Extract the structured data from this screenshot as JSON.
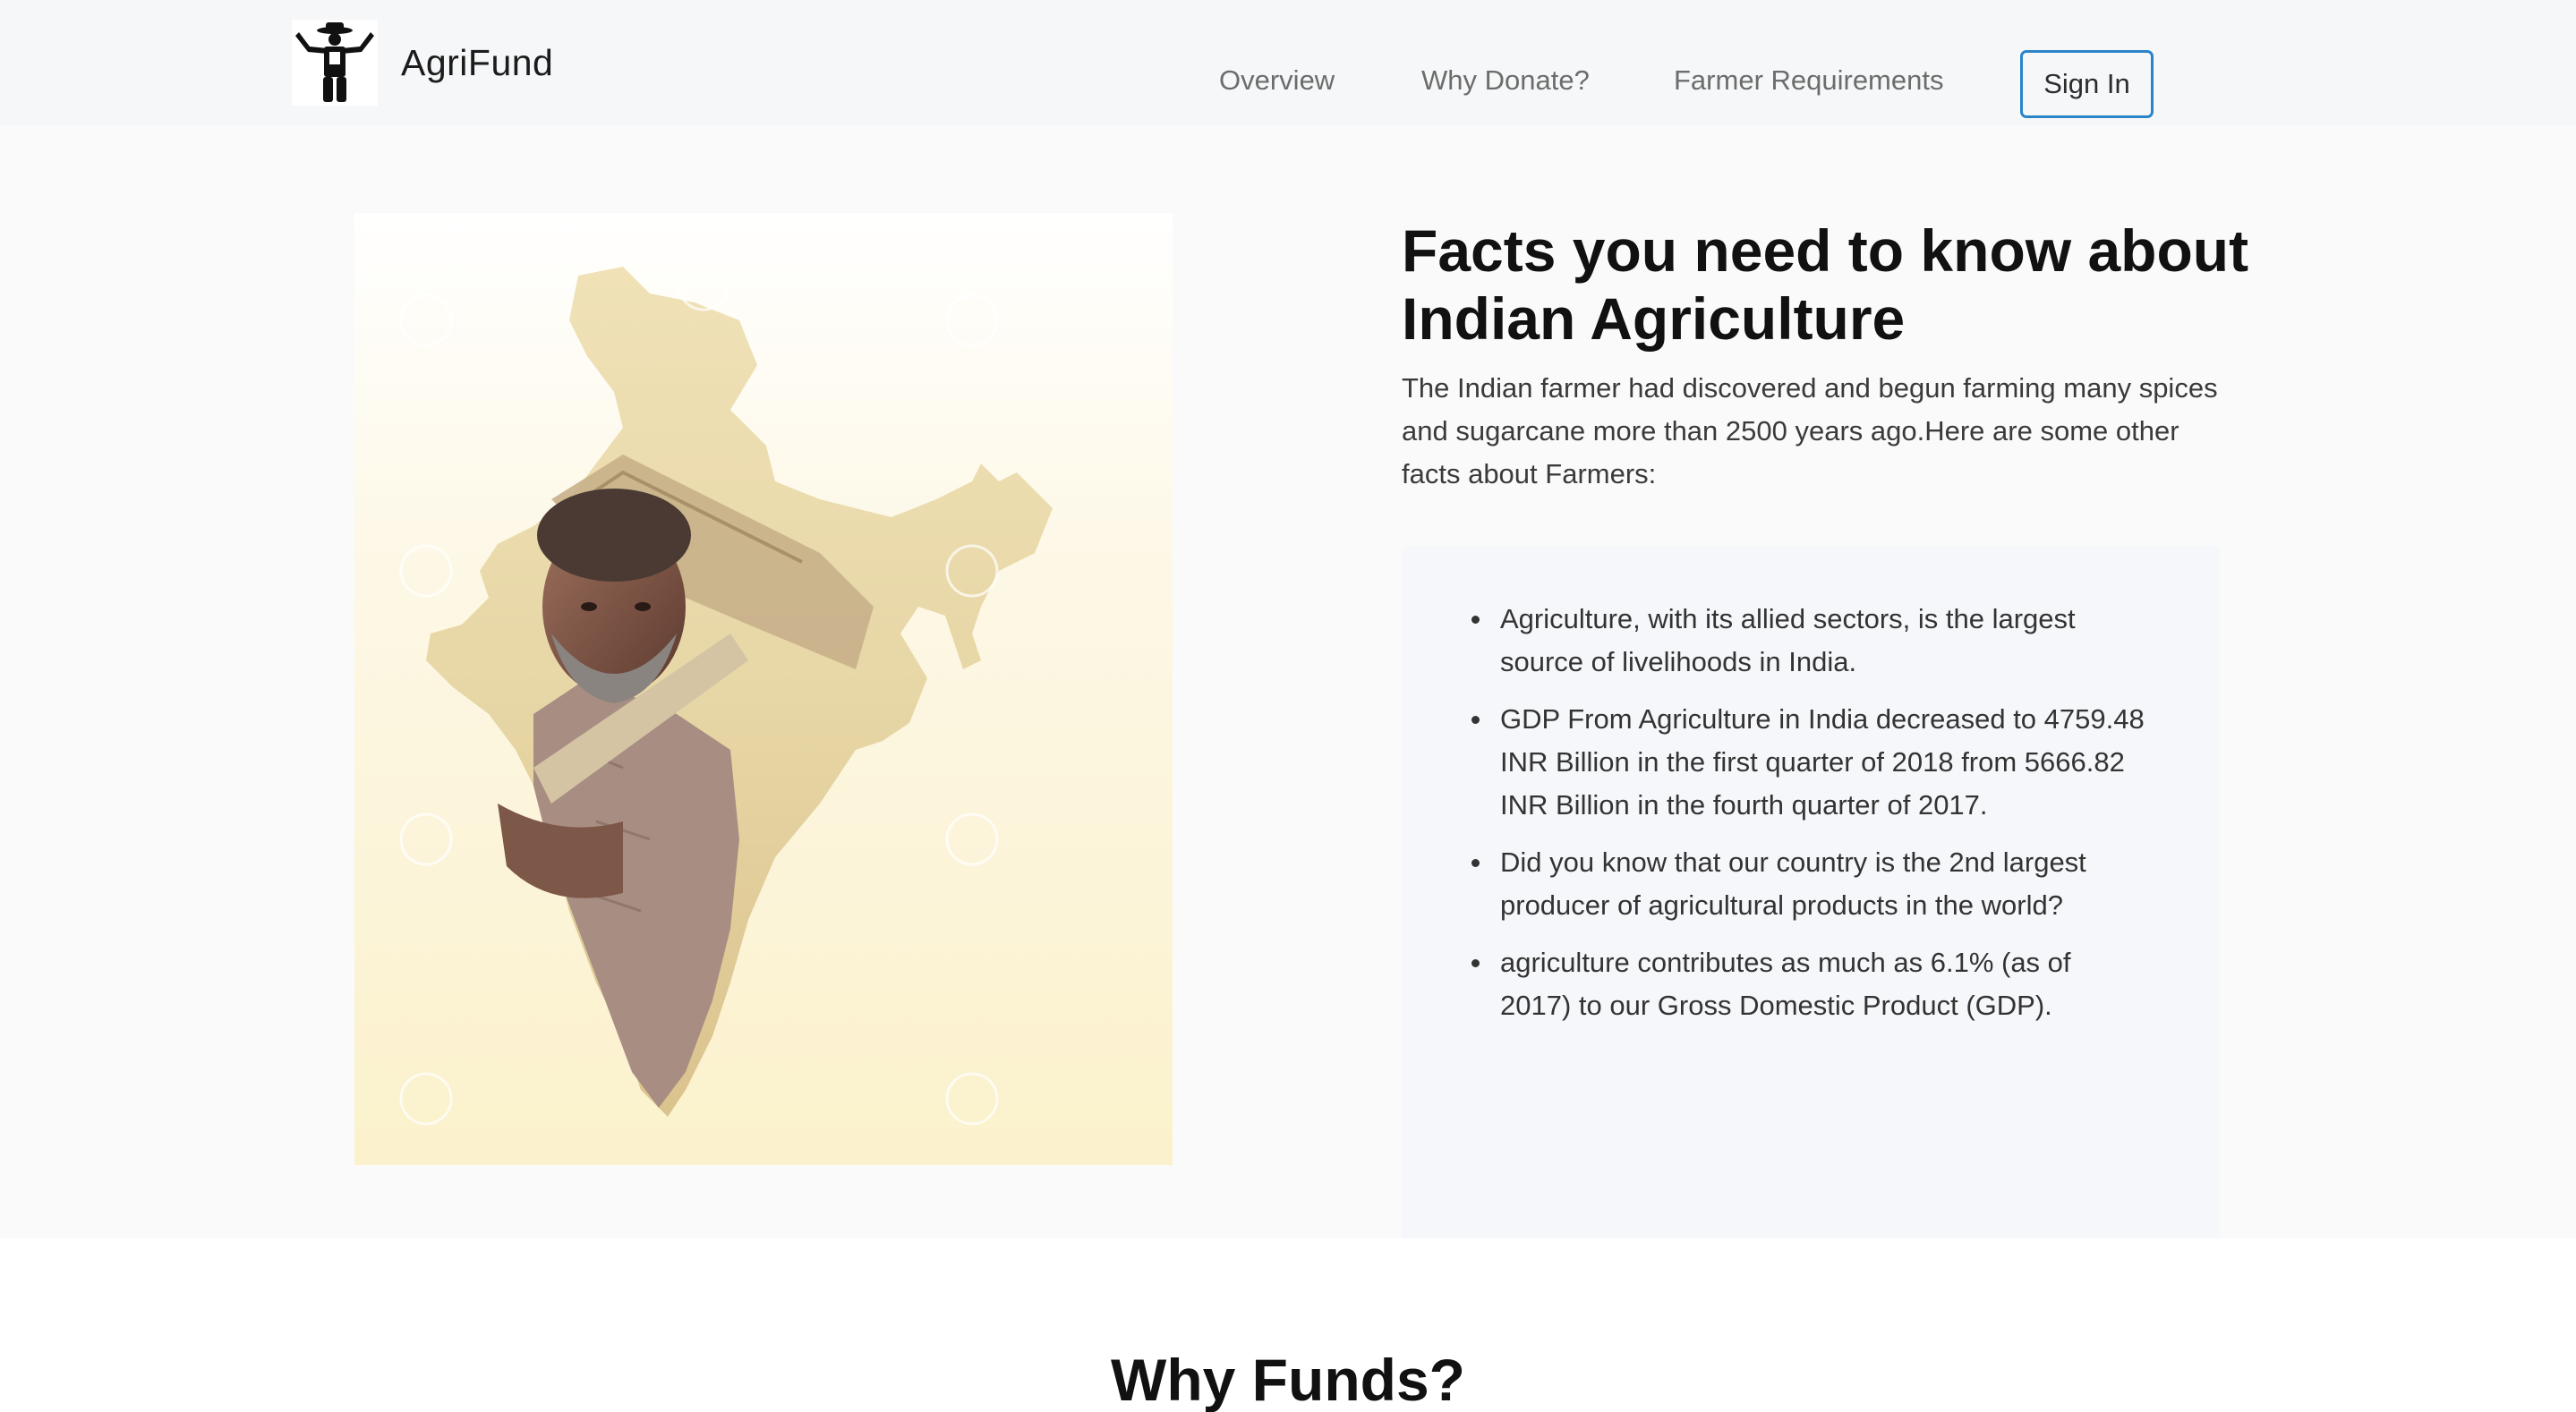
{
  "brand": {
    "name": "AgriFund",
    "logo_icon": "farmer-logo-icon"
  },
  "nav": {
    "links": [
      "Overview",
      "Why Donate?",
      "Farmer Requirements"
    ],
    "signin_label": "Sign In",
    "accent_color": "#2a84c9"
  },
  "facts": {
    "image_icon": "india-map-farmer-image",
    "title": "Facts you need to know about Indian Agriculture",
    "intro": "The Indian farmer had discovered and begun farming many spices and sugarcane more than 2500 years ago.Here are some other facts about Farmers:",
    "items": [
      "Agriculture, with its allied sectors, is the largest source of livelihoods in India.",
      "GDP From Agriculture in India decreased to 4759.48 INR Billion in the first quarter of 2018 from 5666.82 INR Billion in the fourth quarter of 2017.",
      "Did you know that our country is the 2nd largest producer of agricultural products in the world?",
      "agriculture contributes as much as 6.1% (as of 2017) to our Gross Domestic Product (GDP)."
    ]
  },
  "why": {
    "title": "Why Funds?"
  }
}
